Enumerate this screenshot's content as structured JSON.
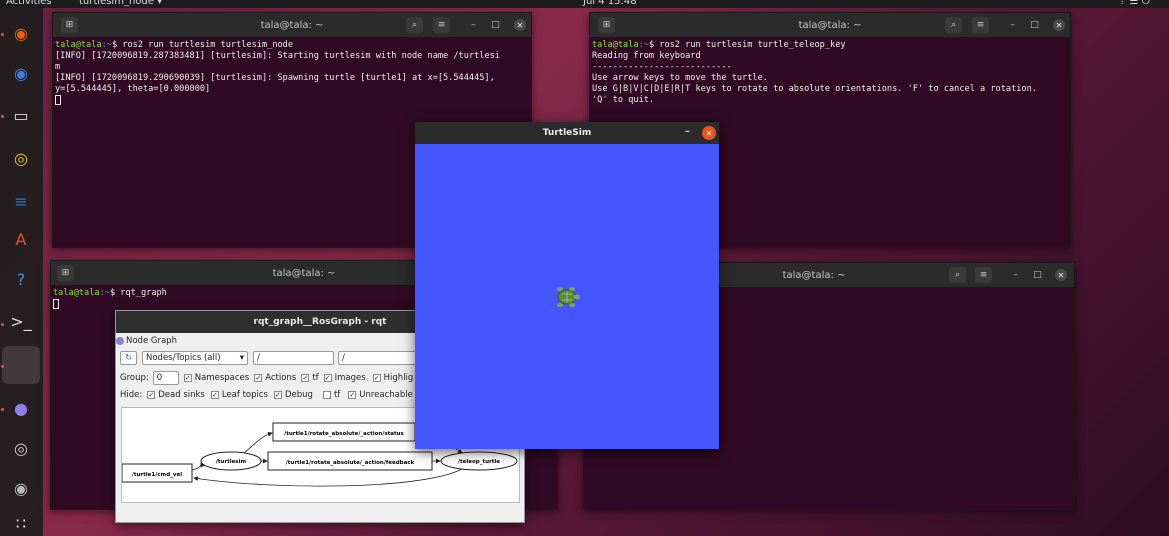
{
  "topbar": {
    "activities": "Activities",
    "app_menu": "turtlesim_node ▾",
    "clock": "Jul 4  15:48",
    "status_icons": "⇡  ☰  ⏻"
  },
  "dock": {
    "items": [
      {
        "name": "firefox-icon",
        "glyph": "◉",
        "color": "#e66000"
      },
      {
        "name": "thunderbird-icon",
        "glyph": "◉",
        "color": "#3d7ee0"
      },
      {
        "name": "files-icon",
        "glyph": "▭",
        "color": "#ddd"
      },
      {
        "name": "rhythmbox-icon",
        "glyph": "◎",
        "color": "#f5c211"
      },
      {
        "name": "writer-icon",
        "glyph": "≡",
        "color": "#2a76c6"
      },
      {
        "name": "software-icon",
        "glyph": "A",
        "color": "#e95420"
      },
      {
        "name": "help-icon",
        "glyph": "?",
        "color": "#3d8fd1"
      },
      {
        "name": "terminal-icon",
        "glyph": ">_",
        "color": "#ddd"
      },
      {
        "name": "rqt-icon",
        "glyph": "",
        "color": "#888"
      },
      {
        "name": "turtlesim-icon",
        "glyph": "●",
        "color": "#8f7fe8"
      },
      {
        "name": "search-app-icon",
        "glyph": "◎",
        "color": "#ccc"
      },
      {
        "name": "disc-icon",
        "glyph": "◉",
        "color": "#bbb"
      },
      {
        "name": "show-apps-icon",
        "glyph": "∷",
        "color": "#eee"
      }
    ]
  },
  "terminals": {
    "t1": {
      "title": "tala@tala: ~",
      "user": "tala@tala",
      "path": ":~",
      "command": "$ ros2 run turtlesim turtlesim_node",
      "lines": [
        "[INFO] [1720096819.287383481] [turtlesim]: Starting turtlesim with node name /turtlesi",
        "m",
        "[INFO] [1720096819.290690039] [turtlesim]: Spawning turtle [turtle1] at x=[5.544445],",
        "y=[5.544445], theta=[0.000000]"
      ]
    },
    "t2": {
      "title": "tala@tala: ~",
      "user": "tala@tala",
      "path": ":~",
      "command": "$ ros2 run turtlesim turtle_teleop_key",
      "lines": [
        "Reading from keyboard",
        "---------------------------",
        "Use arrow keys to move the turtle.",
        "Use G|B|V|C|D|E|R|T keys to rotate to absolute orientations. 'F' to cancel a rotation.",
        "'Q' to quit."
      ]
    },
    "t3": {
      "title": "tala@tala: ~",
      "user": "tala@tala",
      "path": ":~",
      "command": "$ rqt_graph"
    },
    "t4": {
      "title": "tala@tala: ~"
    }
  },
  "turtlesim": {
    "title": "TurtleSim",
    "minimize": "–",
    "close": "✕",
    "background": "#4556ff"
  },
  "rqt": {
    "title": "rqt_graph__RosGraph - rqt",
    "plugin_label": "Node Graph",
    "mode_select": "Nodes/Topics (all)",
    "filter1": "/",
    "filter2": "/",
    "group_label": "Group:",
    "group_value": "0",
    "namespaces": "Namespaces",
    "actions": "Actions",
    "tf": "tf",
    "images": "Images",
    "highlight": "Highlig",
    "hide_label": "Hide:",
    "dead_sinks": "Dead sinks",
    "leaf_topics": "Leaf topics",
    "debug": "Debug",
    "tf2": "tf",
    "unreachable": "Unreachable",
    "graph": {
      "nodes": {
        "turtlesim": "/turtlesim",
        "teleop": "/teleop_turtle",
        "cmd_vel": "/turtle1/cmd_vel",
        "status": "/turtle1/rotate_absolute/_action/status",
        "feedback": "/turtle1/rotate_absolute/_action/feedback"
      }
    }
  }
}
